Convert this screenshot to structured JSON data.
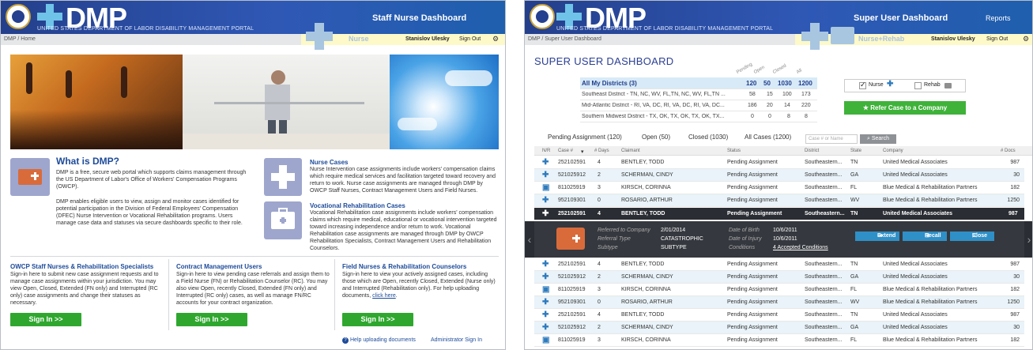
{
  "left": {
    "logo": "DMP",
    "tagline": "UNITED STATES DEPARTMENT OF LABOR DISABILITY MANAGEMENT PORTAL",
    "dashboard_title": "Staff Nurse Dashboard",
    "breadcrumb": "DMP / Home",
    "role": "Nurse",
    "user": "Stanislov Ulesky",
    "signout": "Sign Out",
    "about": {
      "title": "What is DMP?",
      "p1": "DMP is a free, secure web portal which supports claims management through the US Department of Labor's Office of Workers' Compensation Programs (OWCP).",
      "p2": "DMP enables eligible users to view, assign and monitor cases identified for potential participation in the Division of Federal Employees' Compensation (DFEC) Nurse Intervention or Vocational Rehabilitation programs. Users manage case data and statuses via secure dashboards specific to their role."
    },
    "nurse_cases": {
      "title": "Nurse Cases",
      "text": "Nurse Intervention case assignments include workers' compensation claims which require medical services and facilitation targeted toward recovery and return to work. Nurse case assignments are managed through DMP by OWCP Staff Nurses, Contract Management Users and Field Nurses."
    },
    "voc_cases": {
      "title": "Vocational Rehabilitation Cases",
      "text": "Vocational Rehabilitation case assignments include workers' compensation claims which require medical, educational or vocational intervention targeted toward increasing independence and/or return to work. Vocational Rehabilitation case assignments are managed through DMP by OWCP Rehabilitation Specialists, Contract Management Users and Rehabilitation Counselors."
    },
    "col1": {
      "title": "OWCP Staff Nurses & Rehabilitation Specialists",
      "text": "Sign-in here to submit new case assignment requests and to manage case assignments within your jurisdiction. You may view Open, Closed, Extended (FN only) and Interrupted (RC only) case assignments and change their statuses as necessary."
    },
    "col2": {
      "title": "Contract Management Users",
      "text": "Sign-in here to view pending case referrals and assign them to a Field Nurse (FN) or Rehabilitation Counselor (RC). You may also view Open, recently Closed, Extended (FN only) and Interrupted (RC only) cases, as well as manage FN/RC accounts for your contract organization."
    },
    "col3": {
      "title": "Field Nurses & Rehabilitation Counselors",
      "text": "Sign-in here to view your actively assigned cases, including those which are Open, recently Closed, Extended (Nurse only) and Interrupted (Rehabilitation only). For help uploading documents,",
      "link": "click here"
    },
    "signin_label": "Sign In >>",
    "help_link": "Help uploading documents",
    "admin_link": "Administrator Sign In"
  },
  "right": {
    "logo": "DMP",
    "tagline": "UNITED STATES DEPARTMENT OF LABOR DISABILITY MANAGEMENT PORTAL",
    "dashboard_title": "Super User Dashboard",
    "reports": "Reports",
    "breadcrumb": "DMP / Super User Dashboard",
    "role": "Nurse+Rehab",
    "user": "Stanislov Ulesky",
    "signout": "Sign Out",
    "page_title": "SUPER USER DASHBOARD",
    "col_headers": [
      "Pending",
      "Open",
      "Closed",
      "All"
    ],
    "districts": [
      {
        "name": "All My Districts (3)",
        "pending": "120",
        "open": "50",
        "closed": "1030",
        "all": "1200"
      },
      {
        "name": "Southeast District - TN, NC, WV, FL,TN, NC, WV, FL,TN ...",
        "pending": "58",
        "open": "15",
        "closed": "100",
        "all": "173"
      },
      {
        "name": "Mid-Atlantic District - RI, VA, DC, RI, VA, DC, RI, VA, DC...",
        "pending": "186",
        "open": "20",
        "closed": "14",
        "all": "220"
      },
      {
        "name": "Southern Midwest District - TX, OK, TX, OK, TX, OK, TX...",
        "pending": "0",
        "open": "0",
        "closed": "8",
        "all": "8"
      }
    ],
    "filter_nurse": "Nurse",
    "filter_rehab": "Rehab",
    "refer_button": "Refer Case to a Company",
    "tabs": [
      "Pending Assignment (120)",
      "Open (50)",
      "Closed (1030)",
      "All Cases (1200)"
    ],
    "search_placeholder": "Case # or Name",
    "search_button": "Search",
    "table_headers": [
      "N/R",
      "Case #",
      "# Days",
      "Claimant",
      "Status",
      "District",
      "State",
      "Company",
      "# Docs"
    ],
    "rows_top": [
      {
        "icon": "+",
        "case": "252102591",
        "days": "4",
        "claimant": "BENTLEY, TODD",
        "status": "Pending Assignment",
        "district": "Southeastern...",
        "state": "TN",
        "company": "United Medical Associates",
        "docs": "987"
      },
      {
        "icon": "+",
        "case": "521025912",
        "days": "2",
        "claimant": "SCHERMAN, CINDY",
        "status": "Pending Assignment",
        "district": "Southeastern...",
        "state": "GA",
        "company": "United Medical Associates",
        "docs": "30"
      },
      {
        "icon": "▣",
        "case": "811025919",
        "days": "3",
        "claimant": "KIRSCH, CORINNA",
        "status": "Pending Assignment",
        "district": "Southeastern...",
        "state": "FL",
        "company": "Blue Medical & Rehabilitation Partners",
        "docs": "182"
      },
      {
        "icon": "+",
        "case": "952109301",
        "days": "0",
        "claimant": "ROSARIO, ARTHUR",
        "status": "Pending Assignment",
        "district": "Southeastern...",
        "state": "WV",
        "company": "Blue Medical & Rehabilitation Partners",
        "docs": "1250"
      }
    ],
    "expanded_row": {
      "icon": "+",
      "case": "252102591",
      "days": "4",
      "claimant": "BENTLEY, TODD",
      "status": "Pending Assignment",
      "district": "Southeastern...",
      "state": "TN",
      "company": "United Medical Associates",
      "docs": "987"
    },
    "detail": {
      "referred_label": "Referred to Company",
      "referred": "2/01/2014",
      "type_label": "Referral Type",
      "type": "CATASTROPHIC",
      "subtype_label": "Subtype",
      "subtype": "SUBTYPE",
      "dob_label": "Date of Birth",
      "dob": "10/6/2011",
      "doi_label": "Date of Injury",
      "doi": "10/6/2011",
      "cond_label": "Conditions",
      "cond": "4 Accepted Conditions",
      "extend": "Extend",
      "recall": "Recall",
      "close": "Close"
    },
    "rows_bottom": [
      {
        "icon": "+",
        "case": "252102591",
        "days": "4",
        "claimant": "BENTLEY, TODD",
        "status": "Pending Assignment",
        "district": "Southeastern...",
        "state": "TN",
        "company": "United Medical Associates",
        "docs": "987"
      },
      {
        "icon": "+",
        "case": "521025912",
        "days": "2",
        "claimant": "SCHERMAN, CINDY",
        "status": "Pending Assignment",
        "district": "Southeastern...",
        "state": "GA",
        "company": "United Medical Associates",
        "docs": "30"
      },
      {
        "icon": "▣",
        "case": "811025919",
        "days": "3",
        "claimant": "KIRSCH, CORINNA",
        "status": "Pending Assignment",
        "district": "Southeastern...",
        "state": "FL",
        "company": "Blue Medical & Rehabilitation Partners",
        "docs": "182"
      },
      {
        "icon": "+",
        "case": "952109301",
        "days": "0",
        "claimant": "ROSARIO, ARTHUR",
        "status": "Pending Assignment",
        "district": "Southeastern...",
        "state": "WV",
        "company": "Blue Medical & Rehabilitation Partners",
        "docs": "1250"
      },
      {
        "icon": "+",
        "case": "252102591",
        "days": "4",
        "claimant": "BENTLEY, TODD",
        "status": "Pending Assignment",
        "district": "Southeastern...",
        "state": "TN",
        "company": "United Medical Associates",
        "docs": "987"
      },
      {
        "icon": "+",
        "case": "521025912",
        "days": "2",
        "claimant": "SCHERMAN, CINDY",
        "status": "Pending Assignment",
        "district": "Southeastern...",
        "state": "GA",
        "company": "United Medical Associates",
        "docs": "30"
      },
      {
        "icon": "▣",
        "case": "811025919",
        "days": "3",
        "claimant": "KIRSCH, CORINNA",
        "status": "Pending Assignment",
        "district": "Southeastern...",
        "state": "FL",
        "company": "Blue Medical & Rehabilitation Partners",
        "docs": "182"
      }
    ]
  }
}
